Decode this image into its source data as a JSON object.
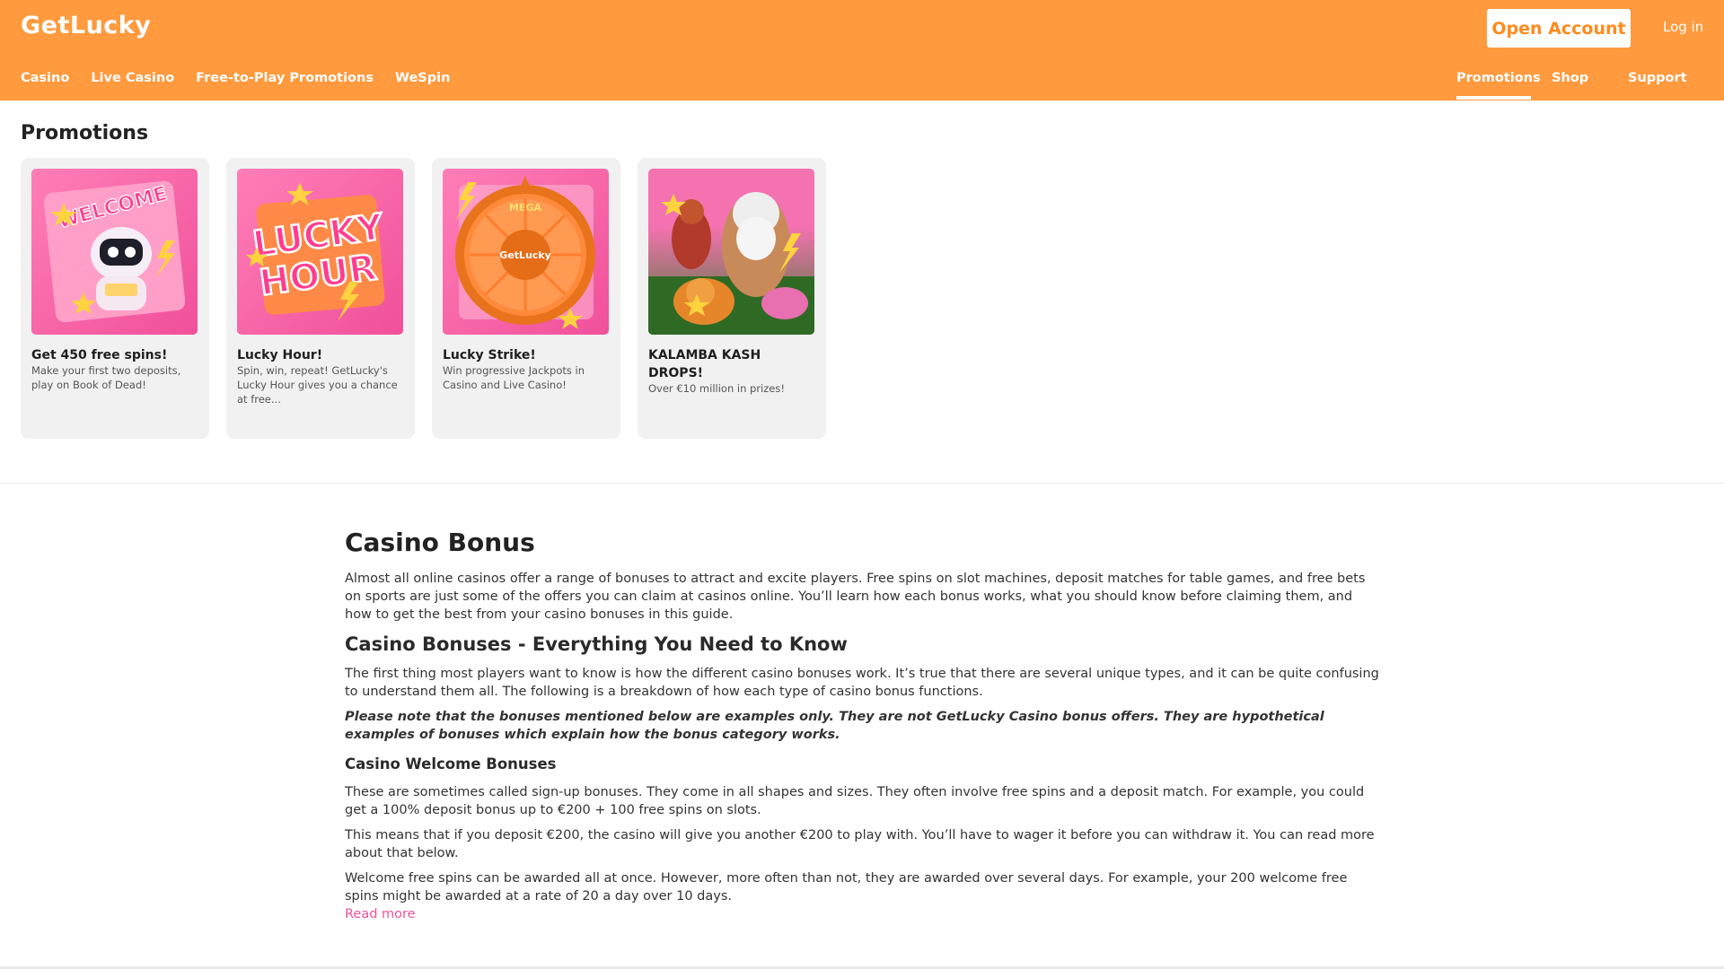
{
  "header": {
    "logo": "GetLucky",
    "open_account": "Open Account",
    "login": "Log in",
    "nav_left": [
      "Casino",
      "Live Casino",
      "Free-to-Play Promotions",
      "WeSpin"
    ],
    "nav_right": [
      "Promotions",
      "Shop",
      "Support"
    ],
    "active_nav": "Promotions",
    "brand_color": "#ff9a3e"
  },
  "promotions": {
    "title": "Promotions",
    "cards": [
      {
        "title": "Get 450 free spins!",
        "desc": "Make your first two deposits, play on Book of Dead!",
        "image_text": "WELCOME"
      },
      {
        "title": "Lucky Hour!",
        "desc": "Spin, win, repeat! GetLucky's Lucky Hour gives you a chance at free...",
        "image_text_1": "LUCKY",
        "image_text_2": "HOUR"
      },
      {
        "title": "Lucky Strike!",
        "desc": "Win progressive Jackpots in Casino and Live Casino!",
        "image_text_1": "MEGA",
        "image_text_2": "GetLucky"
      },
      {
        "title": "KALAMBA KASH DROPS!",
        "desc": "Over €10 million in prizes!"
      }
    ]
  },
  "article": {
    "title": "Casino Bonus",
    "intro": "Almost all online casinos offer a range of bonuses to attract and excite players. Free spins on slot machines, deposit matches for table games, and free bets on sports are just some of the offers you can claim at casinos online. You’ll learn how each bonus works, what you should know before claiming them, and how to get the best from your casino bonuses in this guide.",
    "h2": "Casino Bonuses - Everything You Need to Know",
    "p1": "The first thing most players want to know is how the different casino bonuses work. It’s true that there are several unique types, and it can be quite confusing to understand them all. The following is a breakdown of how each type of casino bonus functions.",
    "note": "Please note that the bonuses mentioned below are examples only. They are not GetLucky Casino bonus offers. They are hypothetical examples of bonuses which explain how the bonus category works.",
    "h3": "Casino Welcome Bonuses",
    "p2": "These are sometimes called sign-up bonuses. They come in all shapes and sizes. They often involve free spins and a deposit match. For example, you could get a 100% deposit bonus up to €200 + 100 free spins on slots.",
    "p3": "This means that if you deposit €200, the casino will give you another €200 to play with. You’ll have to wager it before you can withdraw it. You can read more about that below.",
    "p4": "Welcome free spins can be awarded all at once. However, more often than not, they are awarded over several days. For example, your 200 welcome free spins might be awarded at a rate of 20 a day over 10 days.",
    "read_more": "Read more"
  }
}
